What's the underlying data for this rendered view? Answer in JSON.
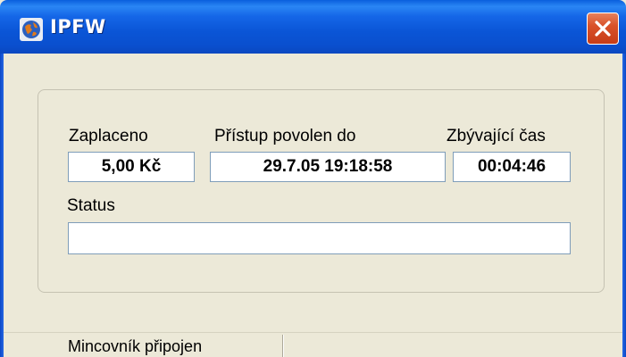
{
  "window": {
    "title": "IPFW",
    "close_icon": "close-icon",
    "app_icon": "globe-icon"
  },
  "fields": {
    "paid_label": "Zaplaceno",
    "paid_value": "5,00 Kč",
    "access_label": "Přístup povolen do",
    "access_value": "29.7.05 19:18:58",
    "remaining_label": "Zbývající čas",
    "remaining_value": "00:04:46",
    "status_label": "Status",
    "status_value": ""
  },
  "statusbar": {
    "text": "Mincovník připojen"
  },
  "colors": {
    "titlebar": "#0a55d6",
    "close_button": "#d9522a",
    "background": "#ece9d8",
    "field_border": "#7f9db9"
  }
}
